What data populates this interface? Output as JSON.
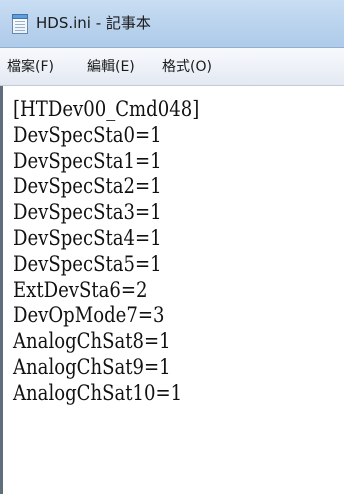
{
  "window": {
    "title": "HDS.ini - 記事本",
    "icon": "notepad-icon"
  },
  "menu": {
    "items": [
      {
        "label": "檔案(F)"
      },
      {
        "label": "編輯(E)"
      },
      {
        "label": "格式(O)"
      }
    ]
  },
  "editor": {
    "lines": [
      "[HTDev00_Cmd048]",
      "DevSpecSta0=1",
      "DevSpecSta1=1",
      "DevSpecSta2=1",
      "DevSpecSta3=1",
      "DevSpecSta4=1",
      "DevSpecSta5=1",
      "ExtDevSta6=2",
      "DevOpMode7=3",
      "AnalogChSat8=1",
      "AnalogChSat9=1",
      "AnalogChSat10=1"
    ]
  },
  "colors": {
    "titlebar": "#bcd4ee",
    "menubar": "#eef2f8",
    "editor_background": "#ffffff",
    "text": "#111111"
  }
}
